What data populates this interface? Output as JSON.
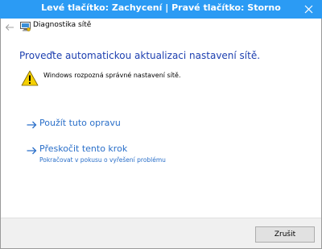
{
  "window": {
    "title": "Levé tlačítko: Zachycení | Pravé tlačítko: Storno",
    "close_icon": "close-icon",
    "titlebar_color": "#2b9bf4"
  },
  "header": {
    "back_icon": "back-arrow-icon",
    "app_icon": "network-diagnostics-icon",
    "app_title": "Diagnostika sítě"
  },
  "main": {
    "heading": "Proveďte automatickou aktualizaci nastavení sítě.",
    "heading_color": "#1e40b0",
    "warning": {
      "icon": "warning-icon",
      "text": "Windows rozpozná správné nastavení sítě."
    },
    "commands": [
      {
        "icon": "arrow-right-icon",
        "title": "Použít tuto opravu",
        "subtitle": ""
      },
      {
        "icon": "arrow-right-icon",
        "title": "Přeskočit tento krok",
        "subtitle": "Pokračovat v pokusu o vyřešení problému"
      }
    ],
    "link_color": "#2a6fc9"
  },
  "footer": {
    "cancel_label": "Zrušit"
  }
}
